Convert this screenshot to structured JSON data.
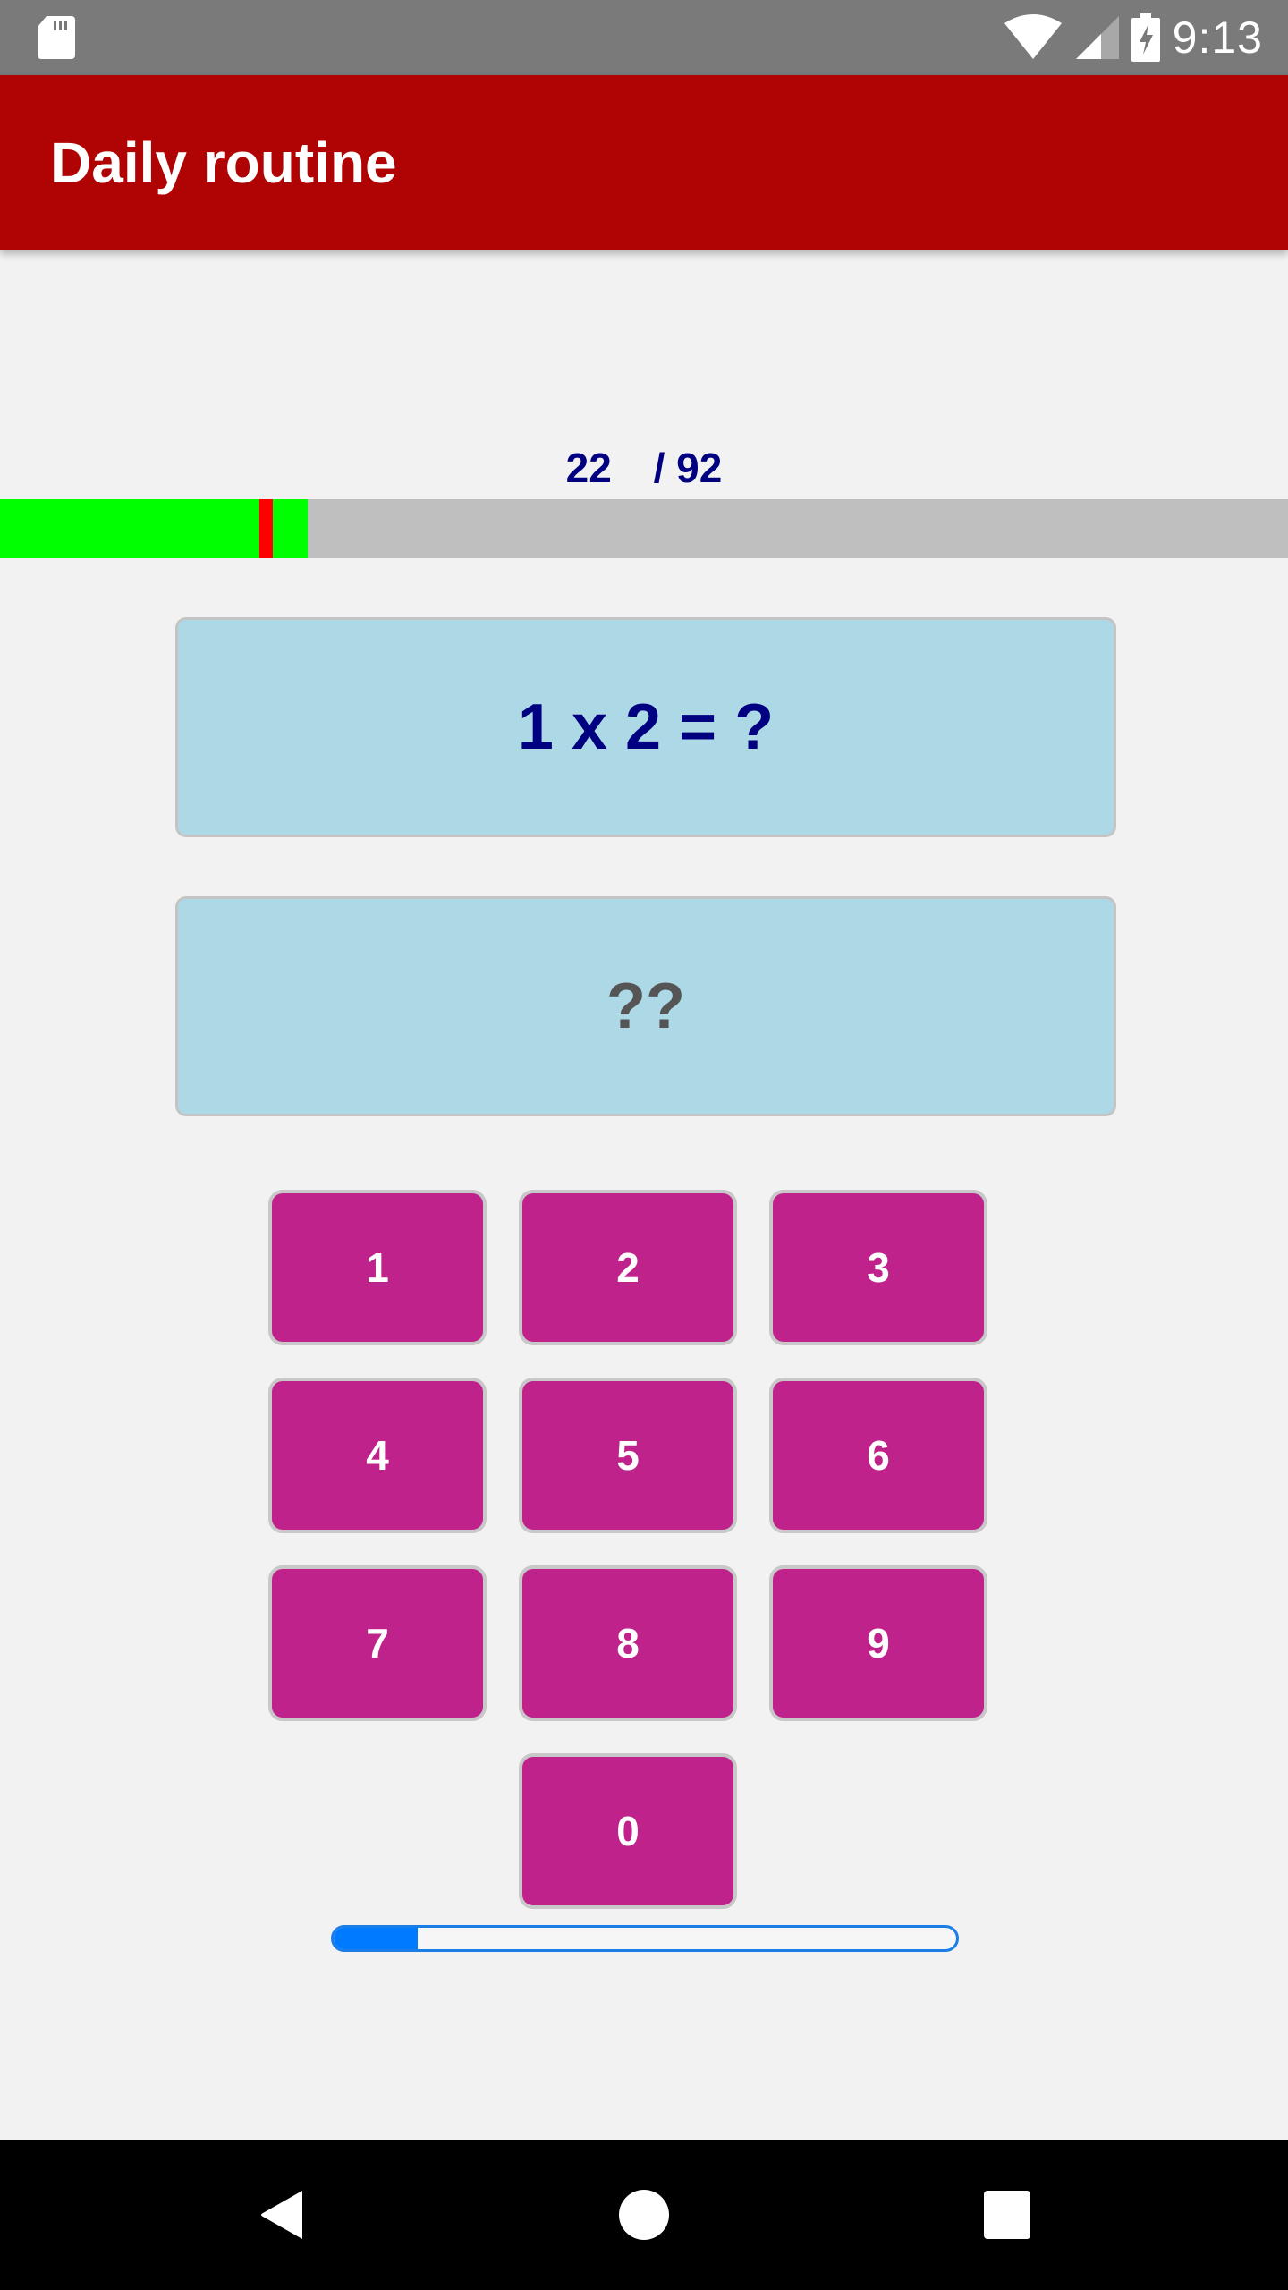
{
  "status_bar": {
    "time": "9:13",
    "icons": [
      "sd-card-icon",
      "wifi-icon",
      "cellular-signal-icon",
      "battery-charging-icon"
    ]
  },
  "app_bar": {
    "title": "Daily routine"
  },
  "progress": {
    "current": "22",
    "separator_total": "/ 92",
    "current_value": 22,
    "total_value": 92,
    "segments": [
      {
        "status": "correct",
        "from": 0,
        "to": 18.5,
        "color": "#00ff00"
      },
      {
        "status": "wrong",
        "from": 18.5,
        "to": 19.5,
        "color": "#ff0000"
      },
      {
        "status": "correct",
        "from": 19.5,
        "to": 22,
        "color": "#00ff00"
      }
    ],
    "track_color": "#bfbfbf"
  },
  "question": {
    "text": "1 x 2 = ?"
  },
  "answer": {
    "text": "??"
  },
  "keypad": {
    "keys": [
      "1",
      "2",
      "3",
      "4",
      "5",
      "6",
      "7",
      "8",
      "9",
      "0"
    ],
    "color": "#c0228c"
  },
  "timer": {
    "fraction": 0.135,
    "color": "#007bff"
  },
  "nav_bar": {
    "buttons": [
      "back",
      "home",
      "recents"
    ]
  }
}
